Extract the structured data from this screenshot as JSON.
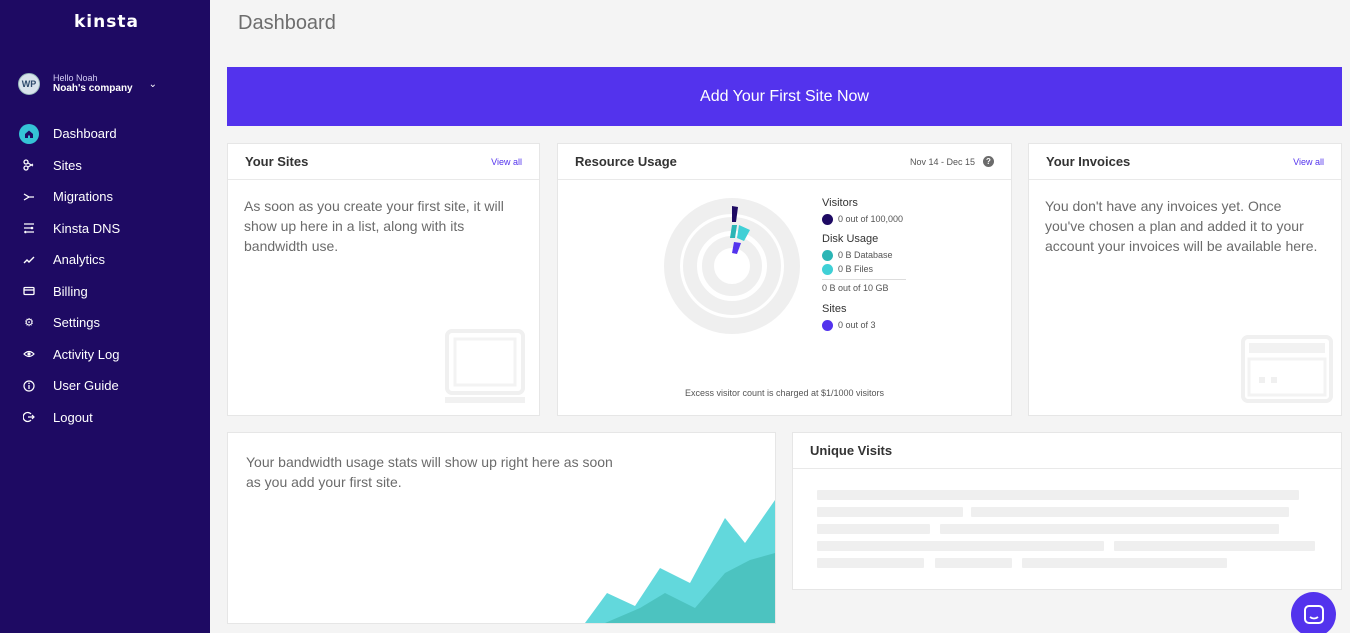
{
  "sidebar": {
    "logo": "kinsta",
    "user": {
      "avatar_text": "WP",
      "greeting": "Hello Noah",
      "company": "Noah's company"
    },
    "items": [
      {
        "label": "Dashboard",
        "icon": "home-icon"
      },
      {
        "label": "Sites",
        "icon": "sites-icon"
      },
      {
        "label": "Migrations",
        "icon": "migrations-icon"
      },
      {
        "label": "Kinsta DNS",
        "icon": "dns-icon"
      },
      {
        "label": "Analytics",
        "icon": "analytics-icon"
      },
      {
        "label": "Billing",
        "icon": "billing-icon"
      },
      {
        "label": "Settings",
        "icon": "gear-icon"
      },
      {
        "label": "Activity Log",
        "icon": "eye-icon"
      },
      {
        "label": "User Guide",
        "icon": "info-icon"
      },
      {
        "label": "Logout",
        "icon": "logout-icon"
      }
    ]
  },
  "header": {
    "title": "Dashboard"
  },
  "banner": {
    "label": "Add Your First Site Now"
  },
  "your_sites": {
    "title": "Your Sites",
    "link": "View all",
    "text": "As soon as you create your first site, it will show up here in a list, along with its bandwidth use."
  },
  "resource_usage": {
    "title": "Resource Usage",
    "date_range": "Nov 14 - Dec 15",
    "help": "?",
    "visitors_title": "Visitors",
    "visitors_value": "0 out of 100,000",
    "disk_title": "Disk Usage",
    "disk_database": "0 B Database",
    "disk_files": "0 B Files",
    "disk_total": "0 B out of 10 GB",
    "sites_title": "Sites",
    "sites_value": "0 out of 3",
    "excess": "Excess visitor count is charged at $1/1000 visitors"
  },
  "your_invoices": {
    "title": "Your Invoices",
    "link": "View all",
    "text": "You don't have any invoices yet. Once you've chosen a plan and added it to your account your invoices will be available here."
  },
  "bandwidth": {
    "text": "Your bandwidth usage stats will show up right here as soon as you add your first site."
  },
  "unique_visits": {
    "title": "Unique Visits"
  },
  "colors": {
    "sidebar": "#1e0a63",
    "accent": "#5333ed",
    "visitors": "#1e0a63",
    "database": "#2bb5b5",
    "files": "#3fd0d6",
    "sites": "#5333ed"
  },
  "chat": {
    "icon": "chat-icon"
  }
}
